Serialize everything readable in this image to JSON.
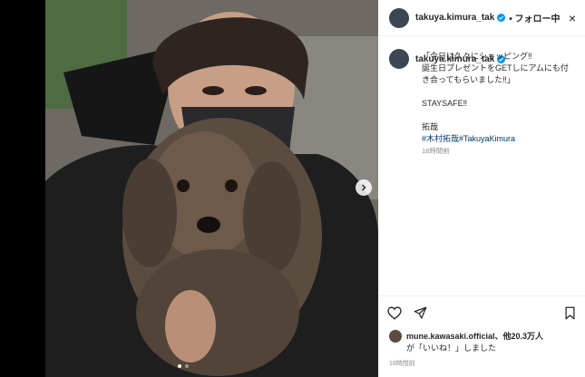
{
  "post": {
    "username": "takuya.kimura_tak",
    "follow_label": "• フォロー中",
    "close_label": "×",
    "caption_lines": [
      "「今日は久々にショッピング‼",
      "誕生日プレゼントをGETしにアムにも付",
      "き合ってもらいました‼」"
    ],
    "staysafe": "STAYSAFE‼",
    "signature": "拓哉",
    "hashtags": "#木村拓哉#TakuyaKimura",
    "time_ago": "18時間前"
  },
  "likes": {
    "line1": "mune.kawasaki.official、他20.3万人",
    "line2": "が「いいね！」しました"
  },
  "footer": {
    "time": "18時間前"
  },
  "colors": {
    "accent": "#0095f6",
    "hashtag": "#00376b",
    "muted": "#8e8e8e"
  },
  "icons": [
    "verified-badge-icon",
    "heart-icon",
    "share-icon",
    "bookmark-icon",
    "next-arrow-icon",
    "close-icon"
  ]
}
